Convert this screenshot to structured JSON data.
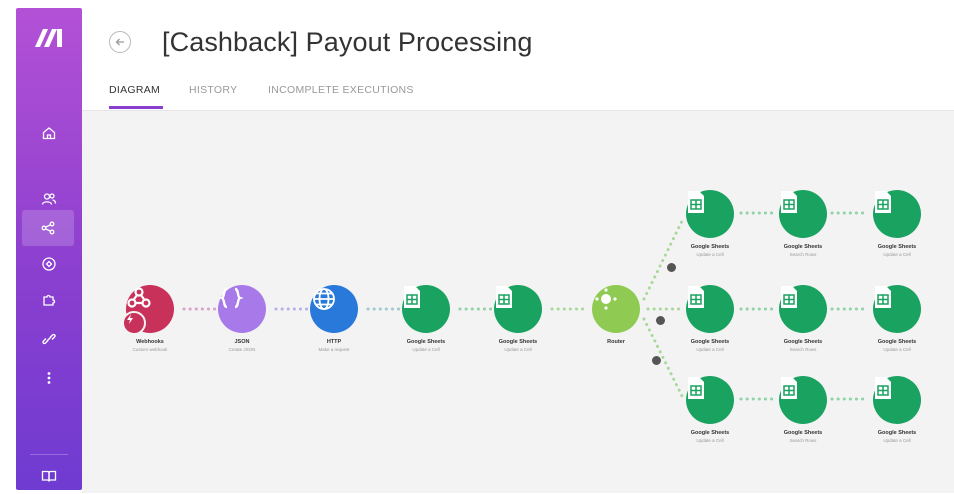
{
  "app": {
    "brand_color": "#8b3fcf",
    "accent_green": "#1aa260"
  },
  "sidebar": {
    "logo": "make-logo",
    "items": [
      {
        "icon": "home-icon"
      },
      {
        "icon": "users-icon"
      },
      {
        "icon": "share-icon",
        "active": true
      },
      {
        "icon": "connections-icon"
      },
      {
        "icon": "puzzle-icon"
      },
      {
        "icon": "link-icon"
      },
      {
        "icon": "more-vertical-icon"
      },
      {
        "icon": "book-icon"
      }
    ]
  },
  "header": {
    "title": "[Cashback] Payout Processing",
    "tabs": [
      {
        "label": "DIAGRAM",
        "active": true
      },
      {
        "label": "HISTORY",
        "active": false
      },
      {
        "label": "INCOMPLETE EXECUTIONS",
        "active": false
      }
    ]
  },
  "scenario": {
    "nodes": [
      {
        "id": "webhooks",
        "label": "Webhooks",
        "sub": "Custom webhook",
        "icon": "webhook-icon",
        "color": "#c8325a"
      },
      {
        "id": "json",
        "label": "JSON",
        "sub": "Create JSON",
        "icon": "json-icon",
        "color": "#a779e9"
      },
      {
        "id": "http",
        "label": "HTTP",
        "sub": "Make a request",
        "icon": "globe-icon",
        "color": "#2879d9"
      },
      {
        "id": "gs1",
        "label": "Google Sheets",
        "sub": "Update a Cell",
        "icon": "sheets-icon",
        "color": "#1aa260"
      },
      {
        "id": "gs2",
        "label": "Google Sheets",
        "sub": "Update a Cell",
        "icon": "sheets-icon",
        "color": "#1aa260"
      },
      {
        "id": "router",
        "label": "Router",
        "sub": "",
        "icon": "router-icon",
        "color": "#8fcb52"
      },
      {
        "id": "b1a",
        "label": "Google Sheets",
        "sub": "Update a Cell",
        "icon": "sheets-icon",
        "color": "#1aa260"
      },
      {
        "id": "b1b",
        "label": "Google Sheets",
        "sub": "Search Rows",
        "icon": "sheets-icon",
        "color": "#1aa260"
      },
      {
        "id": "b1c",
        "label": "Google Sheets",
        "sub": "Update a Cell",
        "icon": "sheets-icon",
        "color": "#1aa260"
      },
      {
        "id": "b2a",
        "label": "Google Sheets",
        "sub": "Update a Cell",
        "icon": "sheets-icon",
        "color": "#1aa260"
      },
      {
        "id": "b2b",
        "label": "Google Sheets",
        "sub": "Search Rows",
        "icon": "sheets-icon",
        "color": "#1aa260"
      },
      {
        "id": "b2c",
        "label": "Google Sheets",
        "sub": "Update a Cell",
        "icon": "sheets-icon",
        "color": "#1aa260"
      },
      {
        "id": "b3a",
        "label": "Google Sheets",
        "sub": "Update a Cell",
        "icon": "sheets-icon",
        "color": "#1aa260"
      },
      {
        "id": "b3b",
        "label": "Google Sheets",
        "sub": "Search Rows",
        "icon": "sheets-icon",
        "color": "#1aa260"
      },
      {
        "id": "b3c",
        "label": "Google Sheets",
        "sub": "Update a Cell",
        "icon": "sheets-icon",
        "color": "#1aa260"
      }
    ]
  }
}
